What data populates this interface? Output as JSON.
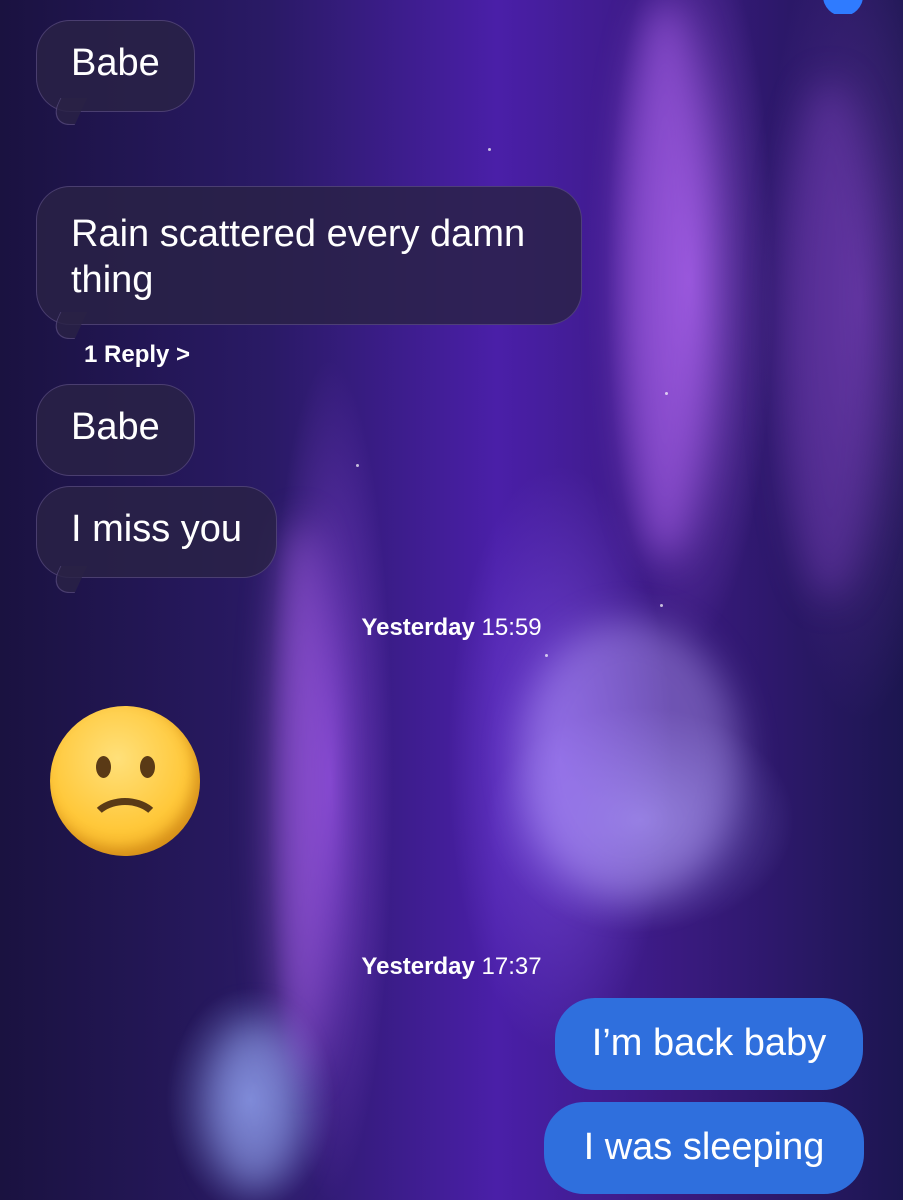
{
  "conversation": {
    "incoming": [
      {
        "text": "Babe"
      },
      {
        "text": "Rain scattered every damn thing"
      },
      {
        "text": "Babe"
      },
      {
        "text": "I miss you"
      }
    ],
    "reply_link": "1 Reply >",
    "timestamps": [
      {
        "day": "Yesterday",
        "time": "15:59"
      },
      {
        "day": "Yesterday",
        "time": "17:37"
      }
    ],
    "emoji_message": "sad-face-emoji",
    "outgoing": [
      {
        "text": "I’m back baby"
      },
      {
        "text": "I was sleeping"
      }
    ]
  },
  "colors": {
    "outgoing_bubble": "#2f6fdd",
    "incoming_bubble": "#2a2246",
    "text": "#ffffff"
  }
}
